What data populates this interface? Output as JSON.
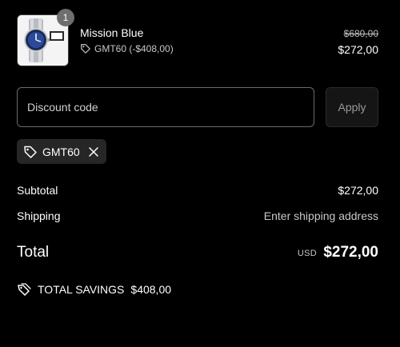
{
  "product": {
    "name": "Mission Blue",
    "quantity": "1",
    "discount_label": "GMT60 (-$408,00)",
    "original_price": "$680,00",
    "final_price": "$272,00",
    "image_icon": "watch-image"
  },
  "discount": {
    "placeholder": "Discount code",
    "apply_label": "Apply",
    "applied_code": "GMT60"
  },
  "totals": {
    "subtotal_label": "Subtotal",
    "subtotal_value": "$272,00",
    "shipping_label": "Shipping",
    "shipping_value": "Enter shipping address",
    "total_label": "Total",
    "currency": "USD",
    "total_value": "$272,00",
    "savings_label": "TOTAL SAVINGS",
    "savings_value": "$408,00"
  },
  "icons": [
    "tag-icon",
    "close-icon",
    "tags-icon"
  ],
  "colors": {
    "background": "#000000",
    "text": "#ffffff",
    "muted": "#c8c8c8",
    "input_border": "#6a6a6a",
    "chip_bg": "#262626",
    "badge_bg": "#6e6e6e"
  }
}
